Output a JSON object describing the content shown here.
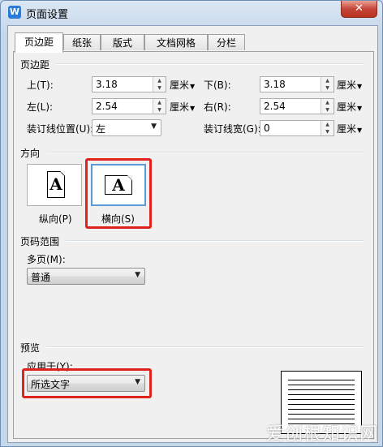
{
  "window": {
    "title": "页面设置",
    "app_icon_glyph": "W",
    "close_glyph": "✕"
  },
  "tabs": [
    {
      "label": "页边距",
      "active": true
    },
    {
      "label": "纸张"
    },
    {
      "label": "版式"
    },
    {
      "label": "文档网格"
    },
    {
      "label": "分栏"
    }
  ],
  "margins": {
    "section_title": "页边距",
    "top": {
      "label": "上(T):",
      "value": "3.18",
      "unit": "厘米"
    },
    "bottom": {
      "label": "下(B):",
      "value": "3.18",
      "unit": "厘米"
    },
    "left": {
      "label": "左(L):",
      "value": "2.54",
      "unit": "厘米"
    },
    "right": {
      "label": "右(R):",
      "value": "2.54",
      "unit": "厘米"
    },
    "gutter_pos": {
      "label": "装订线位置(U):",
      "value": "左"
    },
    "gutter_width": {
      "label": "装订线宽(G):",
      "value": "0",
      "unit": "厘米"
    }
  },
  "orientation": {
    "section_title": "方向",
    "portrait": {
      "label": "纵向(P)",
      "glyph": "A"
    },
    "landscape": {
      "label": "横向(S)",
      "glyph": "A",
      "selected": true
    }
  },
  "pages": {
    "section_title": "页码范围",
    "multi_label": "多页(M):",
    "multi_value": "普通"
  },
  "preview": {
    "section_title": "预览",
    "apply_label": "应用于(Y):",
    "apply_value": "所选文字"
  },
  "watermark": "爱创根知识网",
  "colors": {
    "highlight": "#e0221f",
    "selection": "#5b9bd5",
    "title_bar": "#dbe7f4"
  }
}
